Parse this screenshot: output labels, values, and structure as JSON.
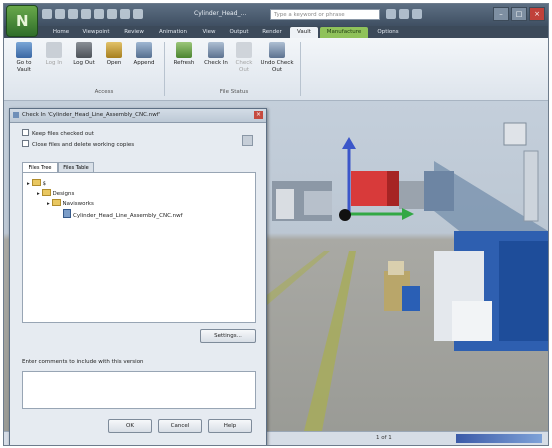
{
  "app": {
    "title": "Cylinder_Head_...",
    "search_placeholder": "Type a keyword or phrase"
  },
  "tabs": [
    "Home",
    "Viewpoint",
    "Review",
    "Animation",
    "View",
    "Output",
    "Render",
    "Vault",
    "Manufacture",
    "Options"
  ],
  "active_tab": "Vault",
  "highlight_tab": "Manufacture",
  "ribbon": {
    "buttons": [
      {
        "label": "Go to Vault"
      },
      {
        "label": "Log In"
      },
      {
        "label": "Log Out"
      },
      {
        "label": "Open"
      },
      {
        "label": "Append"
      },
      {
        "label": "Refresh"
      },
      {
        "label": "Check In"
      },
      {
        "label": "Check Out"
      },
      {
        "label": "Undo Check Out"
      }
    ],
    "groups": [
      {
        "label": "Access"
      },
      {
        "label": "File Status"
      }
    ]
  },
  "dialog": {
    "title": "Check In 'Cylinder_Head_Line_Assembly_CNC.nwf'",
    "options": [
      {
        "label": "Keep files checked out",
        "checked": false
      },
      {
        "label": "Close files and delete working copies",
        "checked": false
      }
    ],
    "tabs": [
      "Files Tree",
      "Files Table"
    ],
    "tree": {
      "root": "$",
      "folder": "Designs",
      "subfolder": "Navisworks",
      "file": "Cylinder_Head_Line_Assembly_CNC.nwf"
    },
    "settings_label": "Settings...",
    "comments_label": "Enter comments to include with this version",
    "ok_label": "OK",
    "cancel_label": "Cancel",
    "help_label": "Help"
  },
  "status": {
    "page": "1 of 1"
  },
  "colors": {
    "titlebar": "#4a5b6e",
    "active_tab_highlight": "#8fc25a",
    "axis_blue": "#3b56c9",
    "axis_green": "#32a845",
    "axis_red": "#d83a3a"
  }
}
